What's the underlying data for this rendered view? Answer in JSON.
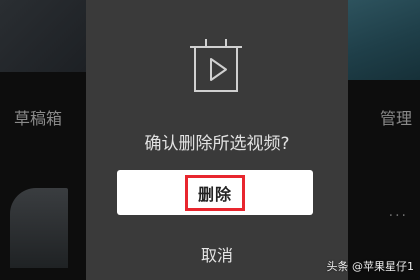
{
  "background": {
    "left_label": "草稿箱",
    "right_label": "管理",
    "more_glyph": "..."
  },
  "dialog": {
    "icon": "video-play-icon",
    "message": "确认删除所选视频?",
    "delete_label": "删除",
    "cancel_label": "取消",
    "highlight_color": "#e8262e"
  },
  "watermark": "头条 @苹果星仔1"
}
